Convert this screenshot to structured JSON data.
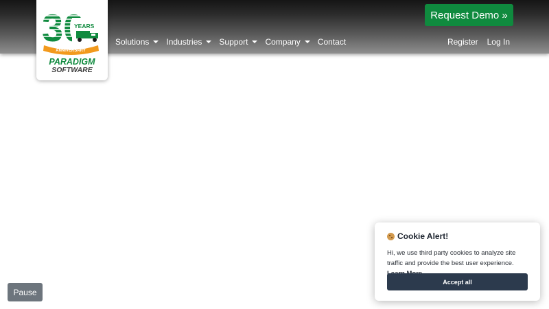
{
  "logo": {
    "digit": "30",
    "years": "YEARS",
    "banner": "ANNIVERSARY",
    "line1": "PARADIGM",
    "line2": "SOFTWARE"
  },
  "nav": {
    "items": [
      {
        "label": "Solutions",
        "dropdown": true
      },
      {
        "label": "Industries",
        "dropdown": true
      },
      {
        "label": "Support",
        "dropdown": true
      },
      {
        "label": "Company",
        "dropdown": true
      },
      {
        "label": "Contact",
        "dropdown": false
      }
    ],
    "register": "Register",
    "login": "Log In"
  },
  "cta": {
    "label": "Request Demo »"
  },
  "pause": {
    "label": "Pause"
  },
  "cookie": {
    "icon": "cookie-icon",
    "title": "Cookie Alert!",
    "text": "Hi, we use third party cookies to analyze site traffic and provide the best user experience.",
    "link": "Learn More",
    "accept": "Accept all"
  },
  "colors": {
    "brand_green": "#0f8a3e",
    "header_dark": "#151515",
    "cookie_button": "#2c3a4d",
    "pause_button": "#6d757d",
    "logo_orange": "#f29a1d"
  }
}
